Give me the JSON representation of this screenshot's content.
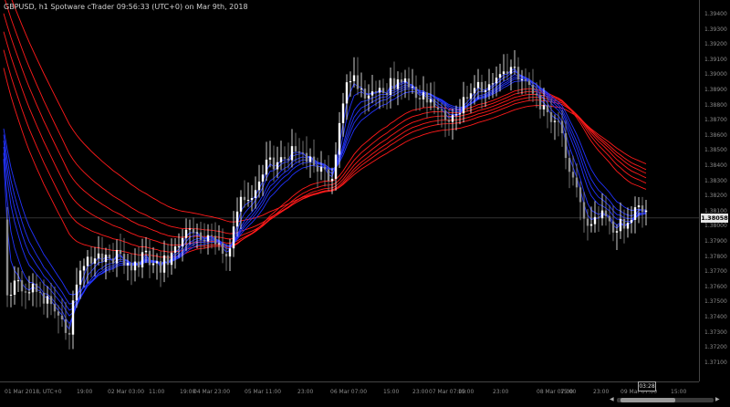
{
  "window": {
    "title": "GBPUSD, h1 Spotware cTrader 09:56:33 (UTC+0) on Mar 9th, 2018"
  },
  "price_axis": {
    "ticks": [
      "1.39400",
      "1.39300",
      "1.39200",
      "1.39100",
      "1.39000",
      "1.38900",
      "1.38800",
      "1.38700",
      "1.38600",
      "1.38500",
      "1.38400",
      "1.38300",
      "1.38200",
      "1.38100",
      "1.38000",
      "1.37900",
      "1.37800",
      "1.37700",
      "1.37600",
      "1.37500",
      "1.37400",
      "1.37300",
      "1.37200",
      "1.37100"
    ],
    "current_price": "1.38058"
  },
  "time_axis": {
    "ticks": [
      "01 Mar 2018, UTC+0",
      "19:00",
      "02 Mar 03:00",
      "11:00",
      "19:00",
      "04 Mar 23:00",
      "05 Mar 11:00",
      "23:00",
      "06 Mar 07:00",
      "15:00",
      "23:00",
      "07 Mar 07:00",
      "15:00",
      "23:00",
      "08 Mar 07:00",
      "15:00",
      "23:00",
      "09 Mar 07:00",
      "15:00"
    ]
  },
  "countdown": "03:28",
  "colors": {
    "background": "#000000",
    "bull_candle": "#ffffff",
    "bear_candle": "#8c8c8c",
    "fast_ma": "#2233ff",
    "slow_ma": "#ff1a1a",
    "price_line": "#333333"
  },
  "scrollbar": {
    "left_arrow": "◀",
    "right_arrow": "▶"
  }
}
